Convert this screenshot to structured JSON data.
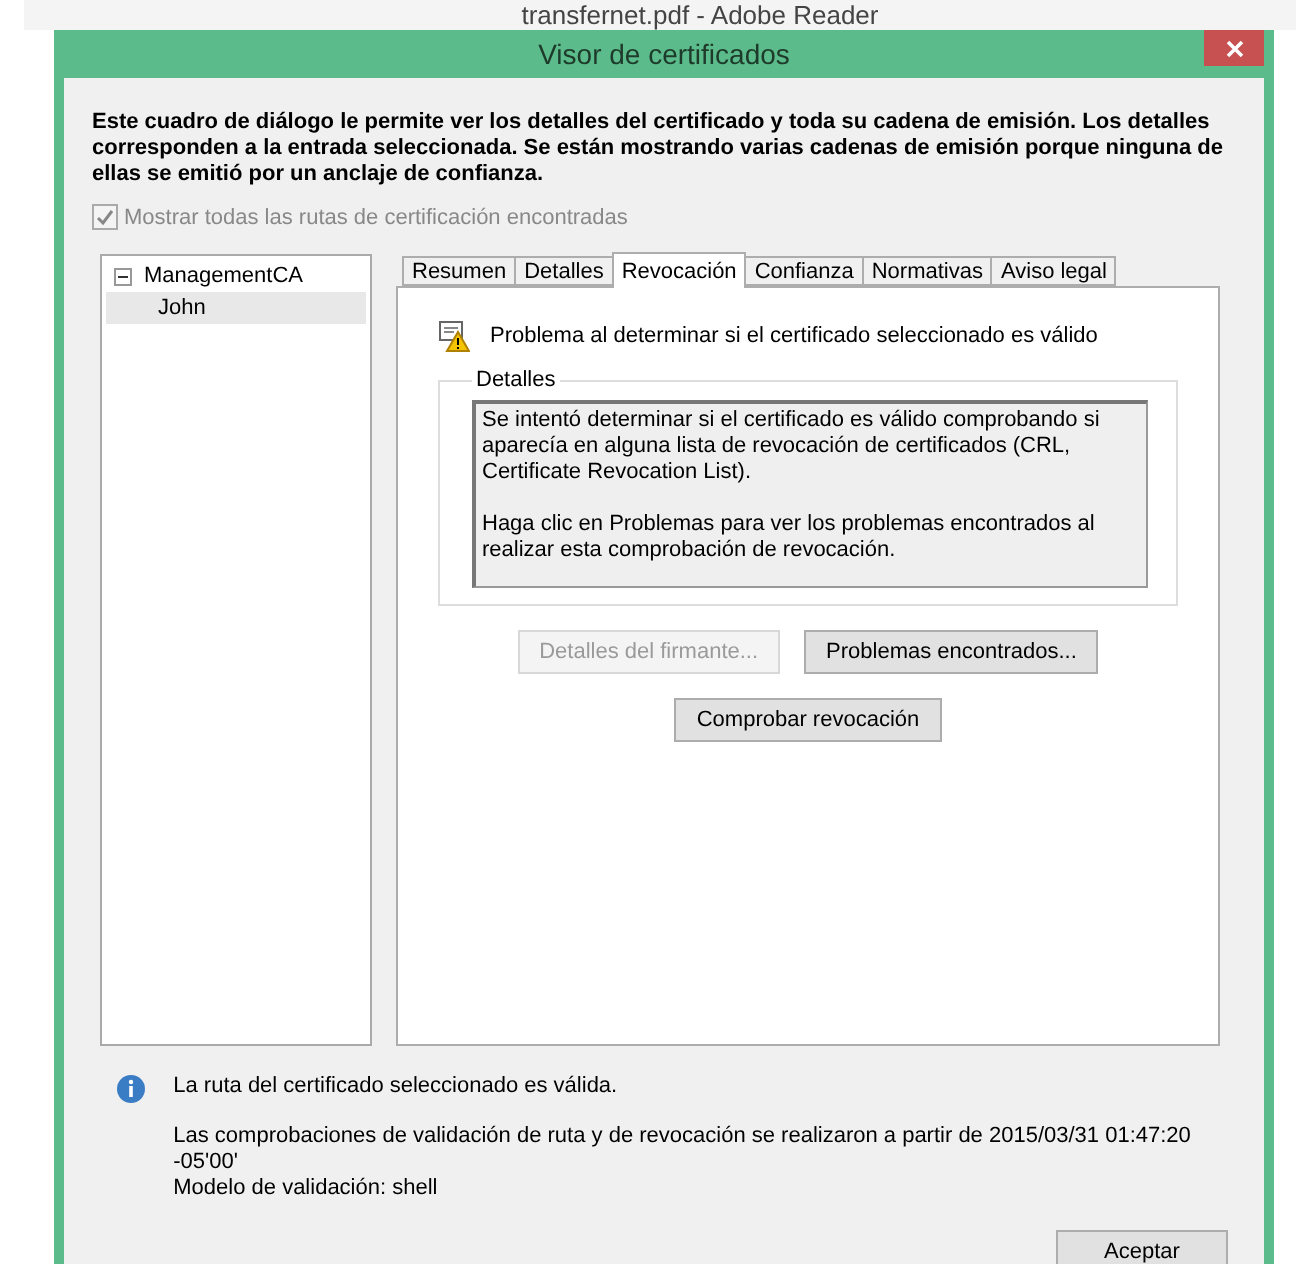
{
  "background_window": {
    "title": "transfernet.pdf - Adobe Reader"
  },
  "dialog": {
    "title": "Visor de certificados"
  },
  "intro": "Este cuadro de diálogo le permite ver los detalles del certificado y toda su cadena de emisión. Los detalles corresponden a la entrada seleccionada. Se están mostrando varias cadenas de emisión porque ninguna de ellas se emitió por un anclaje de confianza.",
  "show_all_paths": {
    "label": "Mostrar todas las rutas de certificación encontradas",
    "checked": true,
    "disabled": true
  },
  "tree": [
    {
      "label": "ManagementCA",
      "expanded": true,
      "selected": false,
      "children": [
        {
          "label": "John",
          "selected": true
        }
      ]
    }
  ],
  "tabs": [
    {
      "label": "Resumen",
      "selected": false
    },
    {
      "label": "Detalles",
      "selected": false
    },
    {
      "label": "Revocación",
      "selected": true
    },
    {
      "label": "Confianza",
      "selected": false
    },
    {
      "label": "Normativas",
      "selected": false
    },
    {
      "label": "Aviso legal",
      "selected": false
    }
  ],
  "status_message": "Problema al determinar si el certificado seleccionado es válido",
  "details": {
    "legend": "Detalles",
    "paragraphs": [
      "Se intentó determinar si el certificado es válido comprobando si aparecía en alguna lista de revocación de certificados (CRL, Certificate Revocation List).",
      "Haga clic en Problemas para ver los problemas encontrados al realizar esta comprobación de revocación."
    ]
  },
  "buttons": [
    {
      "label": "Detalles del firmante...",
      "disabled": true
    },
    {
      "label": "Problemas encontrados...",
      "disabled": false
    }
  ],
  "check_button": {
    "label": "Comprobar revocación",
    "disabled": false
  },
  "footer": {
    "path_status": "La ruta del certificado seleccionado es válida.",
    "checks_info": "Las comprobaciones de validación de ruta y de revocación se realizaron a partir de 2015/03/31 01:47:20 -05'00'",
    "validation_model": "Modelo de validación: shell"
  },
  "ok_button": {
    "label": "Aceptar"
  }
}
